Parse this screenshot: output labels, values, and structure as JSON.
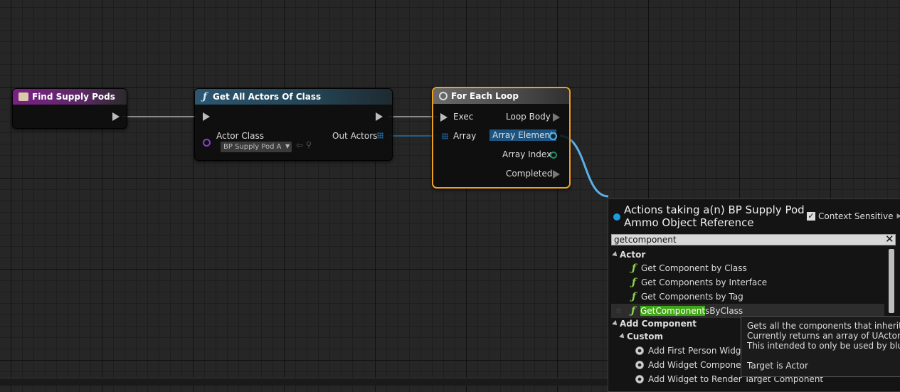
{
  "nodes": {
    "find_supply_pods": {
      "title": "Find Supply Pods"
    },
    "get_all_actors": {
      "title": "Get All Actors Of Class",
      "actor_class_label": "Actor Class",
      "actor_class_value": "BP Supply Pod A",
      "out_actors_label": "Out Actors"
    },
    "for_each_loop": {
      "title": "For Each Loop",
      "exec_label": "Exec",
      "array_label": "Array",
      "loop_body_label": "Loop Body",
      "array_element_label": "Array Element",
      "array_index_label": "Array Index",
      "completed_label": "Completed"
    }
  },
  "action_menu": {
    "title_line1": "Actions taking a(n) BP Supply Pod",
    "title_line2": "Ammo Object Reference",
    "context_sensitive_label": "Context Sensitive",
    "context_sensitive_checked": true,
    "search_value": "getcomponent",
    "categories": [
      {
        "label": "Actor",
        "items": [
          {
            "label": "Get Component by Class",
            "icon": "function-icon"
          },
          {
            "label": "Get Components by Interface",
            "icon": "function-icon"
          },
          {
            "label": "Get Components by Tag",
            "icon": "function-icon"
          },
          {
            "label_highlight": "GetComponent",
            "label_rest": "sByClass",
            "icon": "function-icon",
            "selected": true
          }
        ]
      },
      {
        "label": "Add Component",
        "subcategory": "Custom",
        "items": [
          {
            "label": "Add First Person Widge",
            "icon": "component-icon"
          },
          {
            "label": "Add Widget Componen",
            "icon": "component-icon"
          },
          {
            "label": "Add Widget to Render Target Component",
            "icon": "component-icon"
          }
        ]
      }
    ]
  },
  "tooltip": {
    "line1": "Gets all the components that inherit from",
    "line2": "Currently returns an array of UActorCom",
    "line3": "This intended to only be used by bluepri",
    "target": "Target is Actor"
  },
  "colors": {
    "exec_wire": "#cfcfcf",
    "object_wire": "#5ab0e8",
    "class_pin": "#8a3fd0",
    "selected_node_border": "#f0a020",
    "search_highlight": "#3fa614"
  }
}
